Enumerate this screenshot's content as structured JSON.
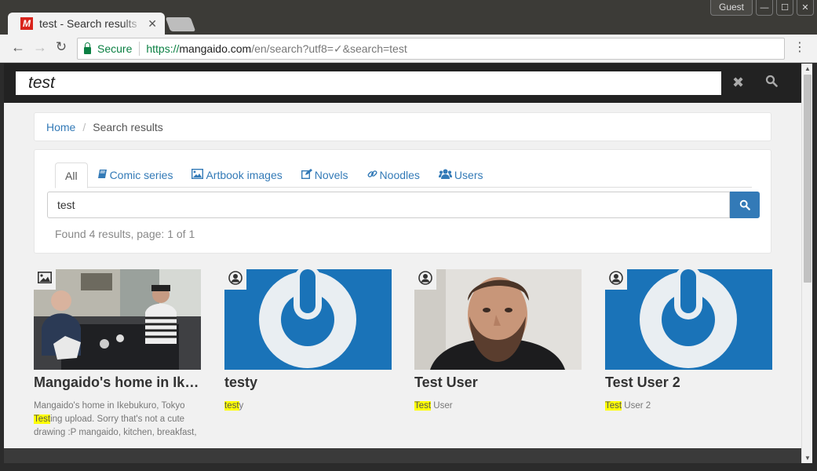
{
  "browser": {
    "tab_title": "test - Search results",
    "favicon_letter": "M",
    "profile": "Guest",
    "omnibox": {
      "secure_label": "Secure",
      "url_scheme": "https://",
      "url_host": "mangaido.com",
      "url_path": "/en/search?utf8=✓&search=test"
    }
  },
  "site_search": {
    "value": "test"
  },
  "breadcrumb": {
    "home": "Home",
    "current": "Search results"
  },
  "search": {
    "tabs": [
      {
        "label": "All",
        "icon": "none",
        "active": true
      },
      {
        "label": "Comic series",
        "icon": "book-icon"
      },
      {
        "label": "Artbook images",
        "icon": "image-icon"
      },
      {
        "label": "Novels",
        "icon": "edit-icon"
      },
      {
        "label": "Noodles",
        "icon": "link-icon"
      },
      {
        "label": "Users",
        "icon": "users-icon"
      }
    ],
    "query": "test",
    "found_text": "Found 4 results, page: 1 of 1"
  },
  "results": [
    {
      "type": "image",
      "badge_icon": "image-icon",
      "title": "Mangaido's home in Ikebukuro, Tokyo",
      "desc_before": "Mangaido's home in Ikebukuro, Tokyo ",
      "highlight": "Test",
      "desc_after": "ing upload. Sorry that's not a cute drawing :P mangaido, kitchen, breakfast,"
    },
    {
      "type": "user",
      "badge_icon": "user-icon",
      "title": "testy",
      "desc_before": "",
      "highlight": "test",
      "desc_after": "y"
    },
    {
      "type": "user",
      "badge_icon": "user-icon",
      "title": "Test User",
      "desc_before": "",
      "highlight": "Test",
      "desc_after": " User"
    },
    {
      "type": "user",
      "badge_icon": "user-icon",
      "title": "Test User 2",
      "desc_before": "",
      "highlight": "Test",
      "desc_after": " User 2"
    }
  ],
  "colors": {
    "link": "#337ab7",
    "highlight": "#ffff00",
    "avatar_blue": "#1a73b8",
    "brand_red": "#d9241c"
  }
}
